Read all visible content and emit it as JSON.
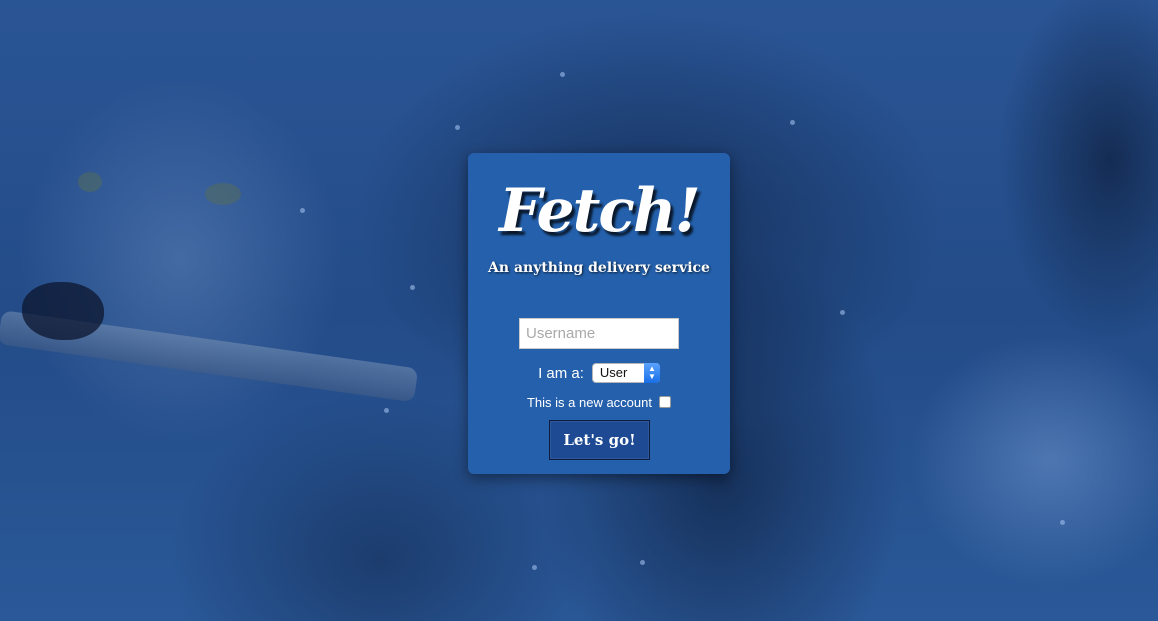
{
  "app": {
    "logo_text": "Fetch!",
    "tagline": "An anything delivery service"
  },
  "form": {
    "username_placeholder": "Username",
    "username_value": "",
    "role_label": "I am a:",
    "role_selected": "User",
    "new_account_label": "This is a new account",
    "new_account_checked": false,
    "submit_label": "Let's go!"
  },
  "colors": {
    "card_background": "#2460ab",
    "page_overlay": "#244f8a",
    "button_background": "#1d4a93",
    "select_accent": "#1a6fe6"
  }
}
